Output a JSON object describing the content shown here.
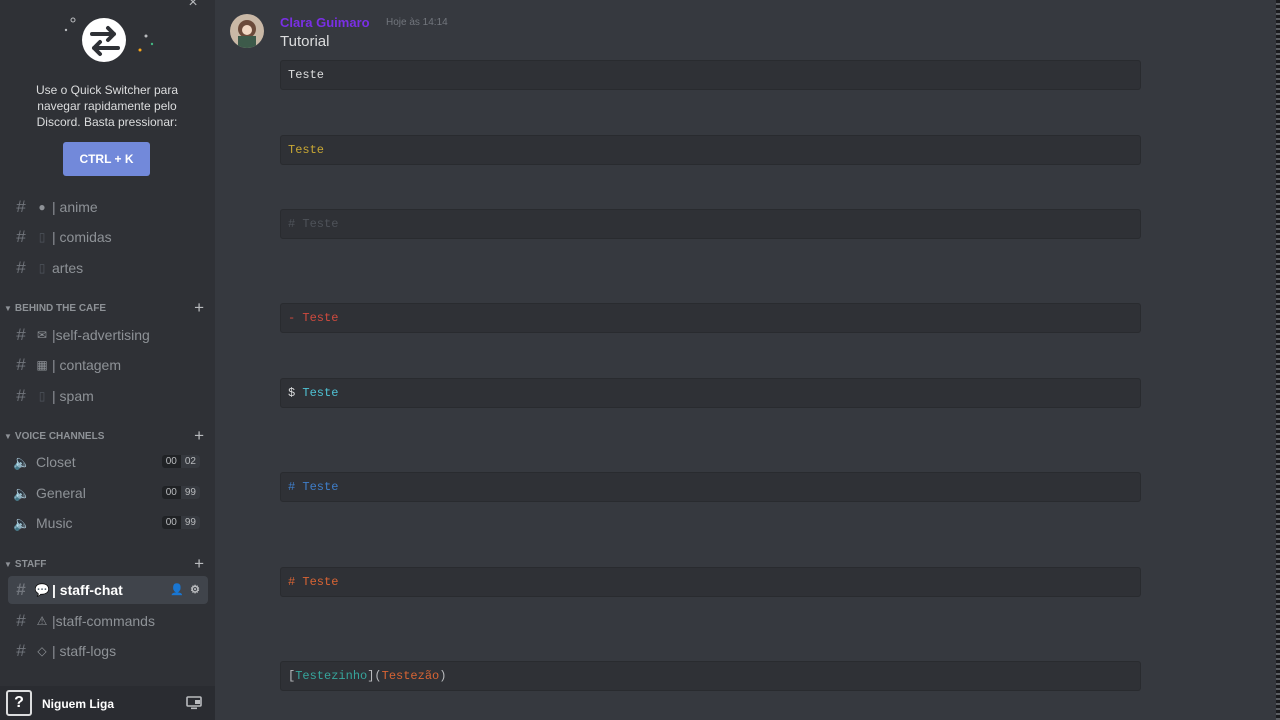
{
  "quick_switcher": {
    "description": "Use o Quick Switcher para navegar rapidamente pelo Discord. Basta pressionar:",
    "shortcut": "CTRL + K"
  },
  "channels_top": [
    {
      "emoji": "●",
      "label": "| anime"
    },
    {
      "emoji": "",
      "label": "| comidas"
    },
    {
      "emoji": "",
      "label": "artes"
    }
  ],
  "category_behind": "BEHIND THE CAFE",
  "channels_behind": [
    {
      "emoji": "✉",
      "label": "|self-advertising"
    },
    {
      "emoji": "▦",
      "label": "| contagem"
    },
    {
      "emoji": "",
      "label": "| spam"
    }
  ],
  "category_voice": "VOICE CHANNELS",
  "voice_channels": [
    {
      "label": "Closet",
      "count": "00",
      "limit": "02"
    },
    {
      "label": "General",
      "count": "00",
      "limit": "99"
    },
    {
      "label": "Music",
      "count": "00",
      "limit": "99"
    }
  ],
  "category_staff": "STAFF",
  "channels_staff": [
    {
      "emoji": "💬",
      "label": "| staff-chat",
      "active": true
    },
    {
      "emoji": "⚠",
      "label": "|staff-commands"
    },
    {
      "emoji": "◇",
      "label": "| staff-logs"
    }
  ],
  "user": {
    "name": "Niguem Liga"
  },
  "message": {
    "author": "Clara Guimaro",
    "time": "Hoje às 14:14",
    "text": "Tutorial"
  },
  "code_blocks": [
    {
      "text": "Teste"
    },
    {
      "text": "Teste"
    },
    {
      "text": "# Teste"
    },
    {
      "text": "- Teste"
    },
    {
      "prefix": "$ ",
      "text": "Teste"
    },
    {
      "text": "# Teste"
    },
    {
      "text": "# Teste"
    },
    {
      "open": "[",
      "link_text": "Testezinho",
      "mid": "](",
      "link_url": "Testezão",
      "close": ")"
    }
  ],
  "colors": {
    "background": "#36393f",
    "sidebar": "#2f3136",
    "accent": "#7289da",
    "author": "#7a2fe5"
  }
}
